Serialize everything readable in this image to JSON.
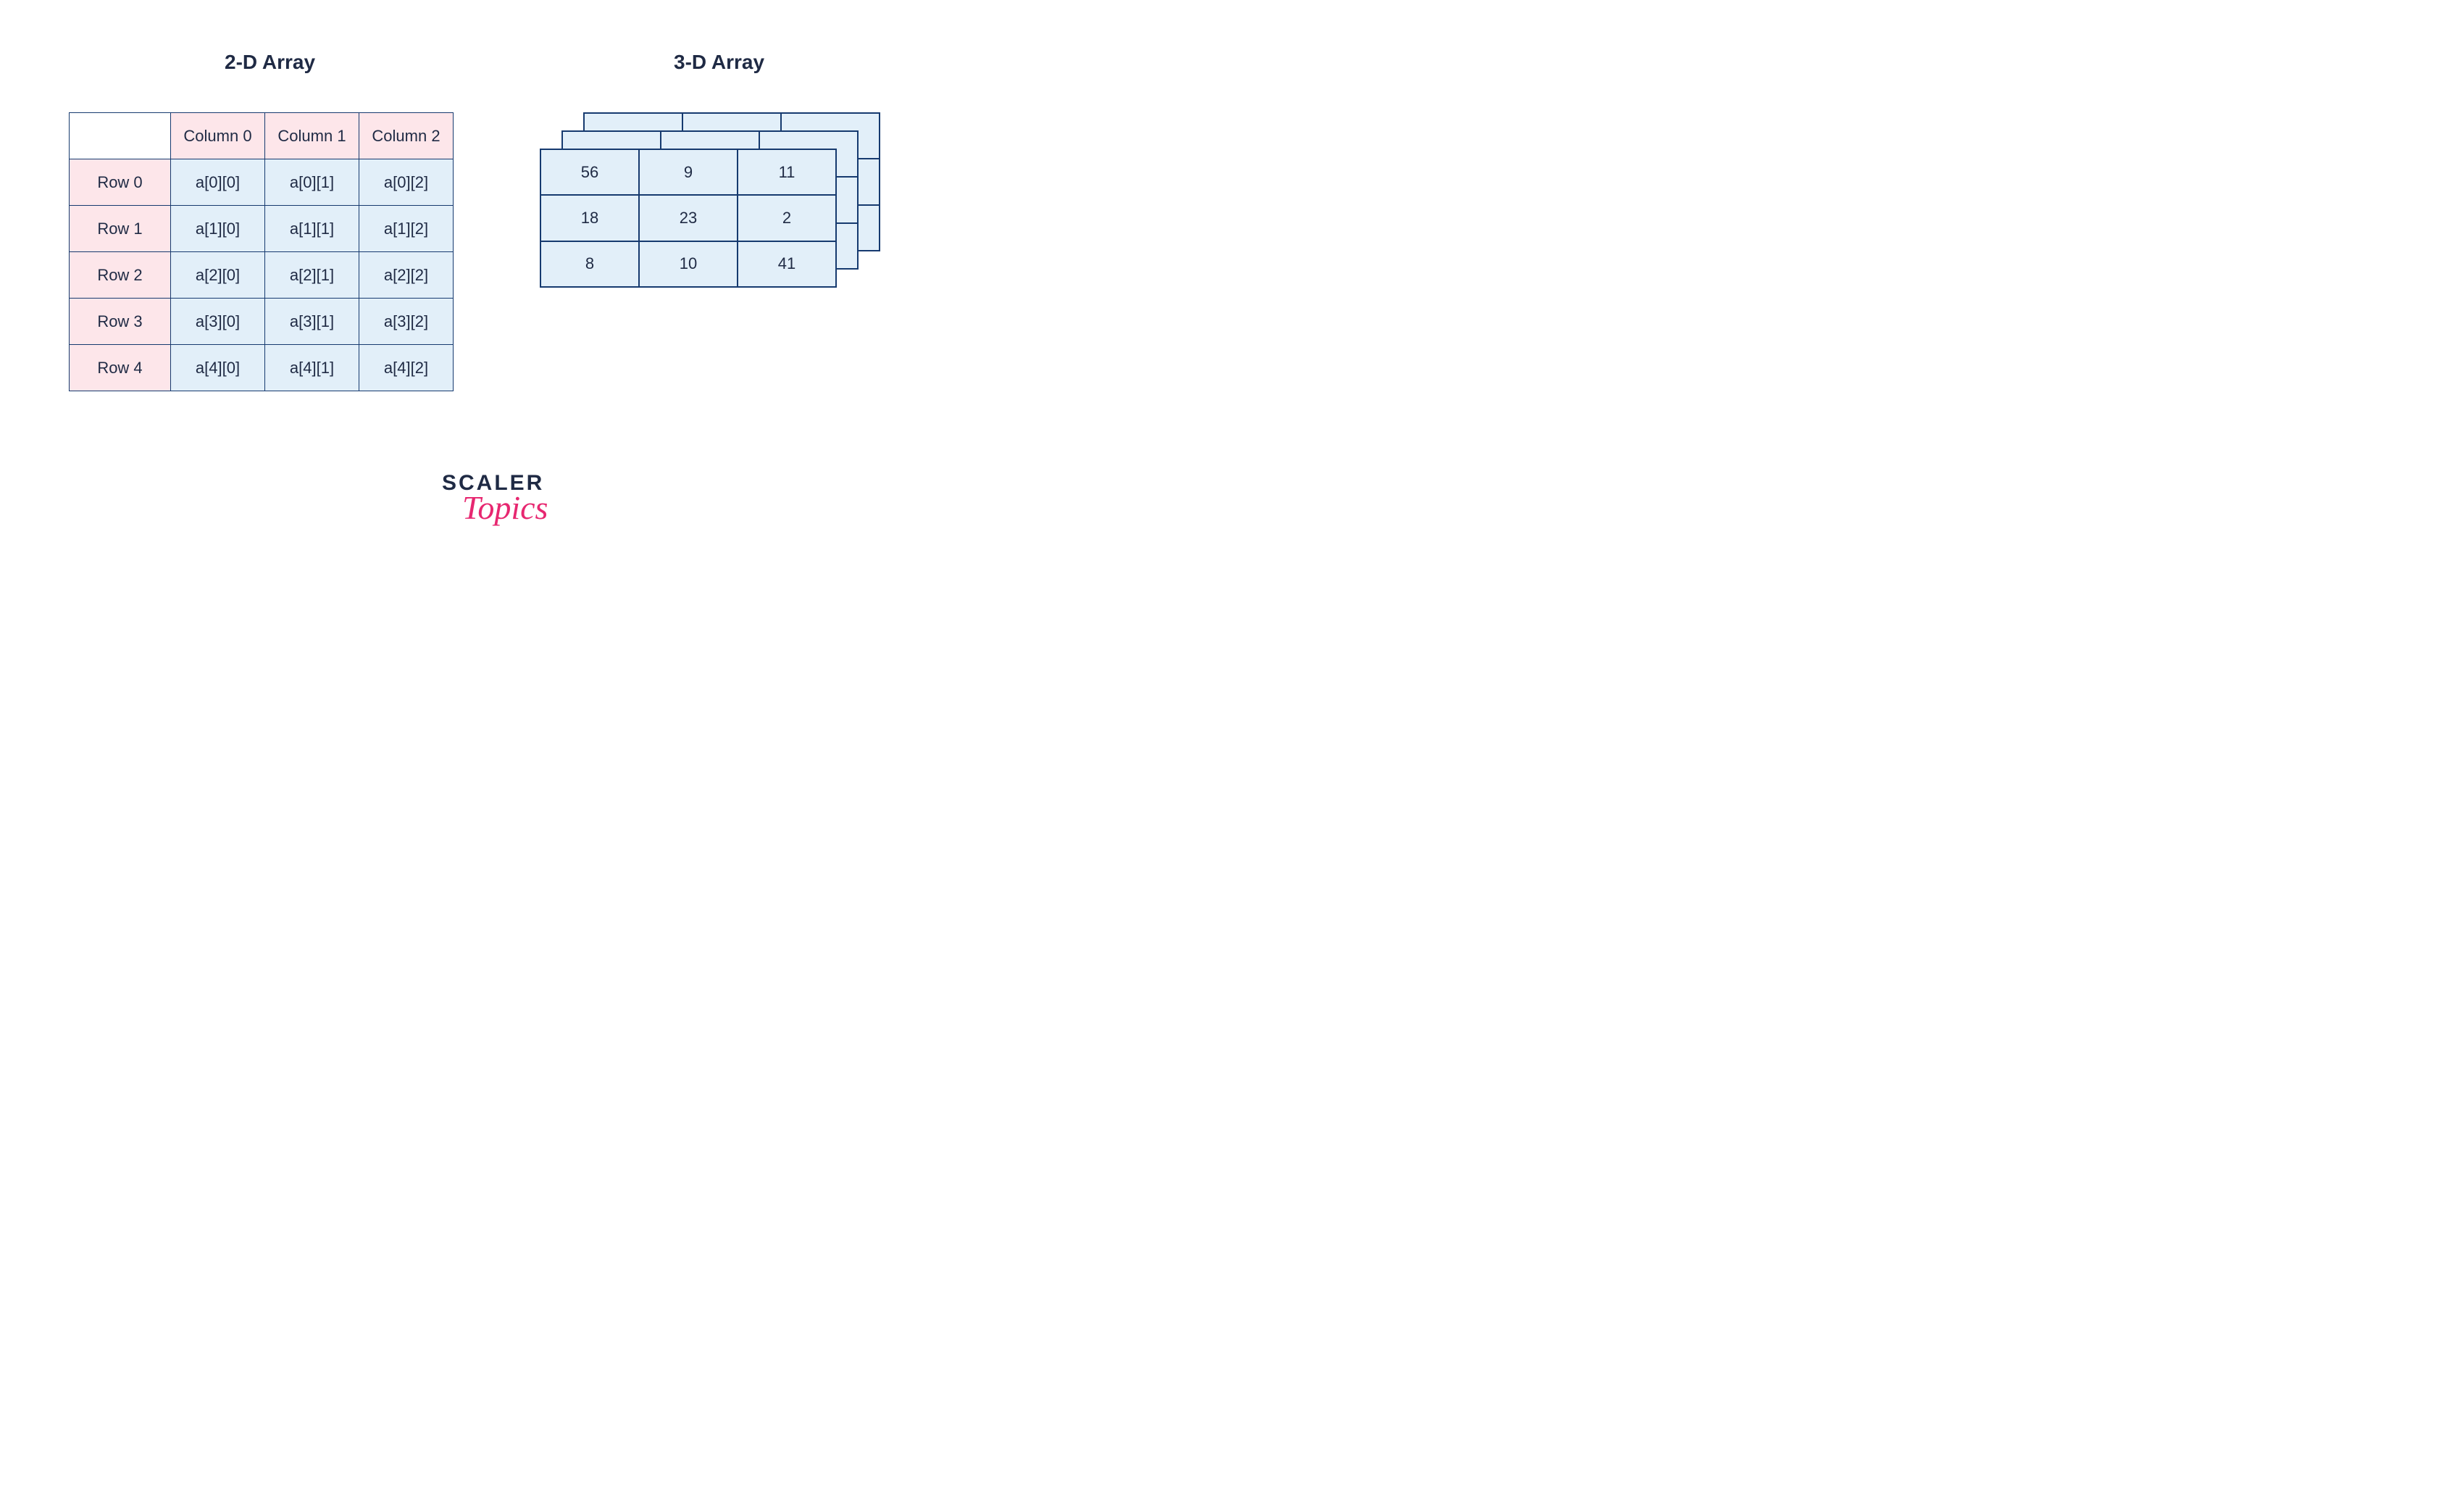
{
  "titles": {
    "two_d": "2-D Array",
    "three_d": "3-D Array"
  },
  "two_d": {
    "corner": "",
    "col_headers": [
      "Column 0",
      "Column 1",
      "Column 2"
    ],
    "row_headers": [
      "Row 0",
      "Row 1",
      "Row 2",
      "Row 3",
      "Row 4"
    ],
    "cells": [
      [
        "a[0][0]",
        "a[0][1]",
        "a[0][2]"
      ],
      [
        "a[1][0]",
        "a[1][1]",
        "a[1][2]"
      ],
      [
        "a[2][0]",
        "a[2][1]",
        "a[2][2]"
      ],
      [
        "a[3][0]",
        "a[3][1]",
        "a[3][2]"
      ],
      [
        "a[4][0]",
        "a[4][1]",
        "a[4][2]"
      ]
    ]
  },
  "three_d": {
    "front_layer": [
      [
        "56",
        "9",
        "11"
      ],
      [
        "18",
        "23",
        "2"
      ],
      [
        "8",
        "10",
        "41"
      ]
    ]
  },
  "logo": {
    "line1": "SCALER",
    "line2": "Topics"
  },
  "colors": {
    "border": "#163a6f",
    "pink_header": "#fde6ea",
    "blue_cell": "#e2eff9",
    "text": "#1f2a44",
    "brand_pink": "#e72770"
  }
}
